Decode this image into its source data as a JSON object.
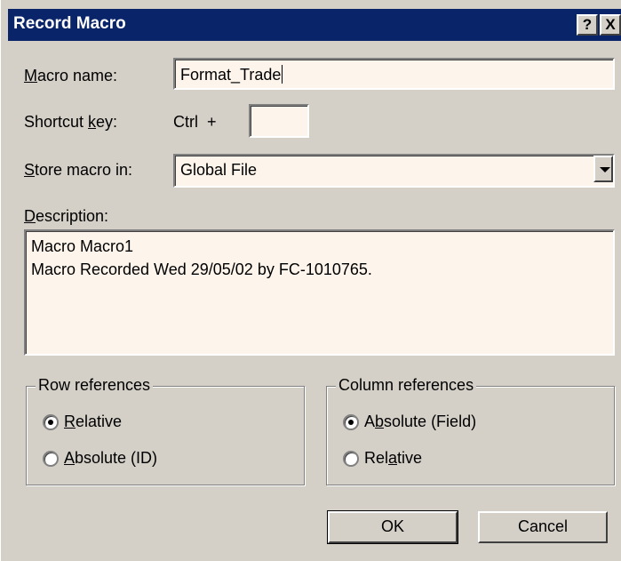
{
  "window": {
    "title": "Record Macro",
    "help_glyph": "?",
    "close_glyph": "X"
  },
  "macro_name": {
    "label_underline": "M",
    "label_rest": "acro name:",
    "value": "Format_Trade"
  },
  "shortcut": {
    "label_before": "Shortcut ",
    "label_underline": "k",
    "label_after": "ey:",
    "prefix": "Ctrl  +",
    "value": ""
  },
  "store": {
    "label_underline": "S",
    "label_rest": "tore macro in:",
    "value": "Global File"
  },
  "description": {
    "label_underline": "D",
    "label_rest": "escription:",
    "lines": [
      "Macro Macro1",
      "Macro Recorded Wed 29/05/02 by FC-1010765."
    ]
  },
  "row_references": {
    "title": "Row references",
    "options": [
      {
        "u": "R",
        "rest": "elative",
        "before": "",
        "checked": true
      },
      {
        "u": "A",
        "rest": "bsolute (ID)",
        "before": "",
        "checked": false
      }
    ]
  },
  "column_references": {
    "title": "Column references",
    "options": [
      {
        "before": "A",
        "u": "b",
        "rest": "solute (Field)",
        "checked": true
      },
      {
        "before": "Rel",
        "u": "a",
        "rest": "tive",
        "checked": false
      }
    ]
  },
  "buttons": {
    "ok": "OK",
    "cancel": "Cancel"
  }
}
